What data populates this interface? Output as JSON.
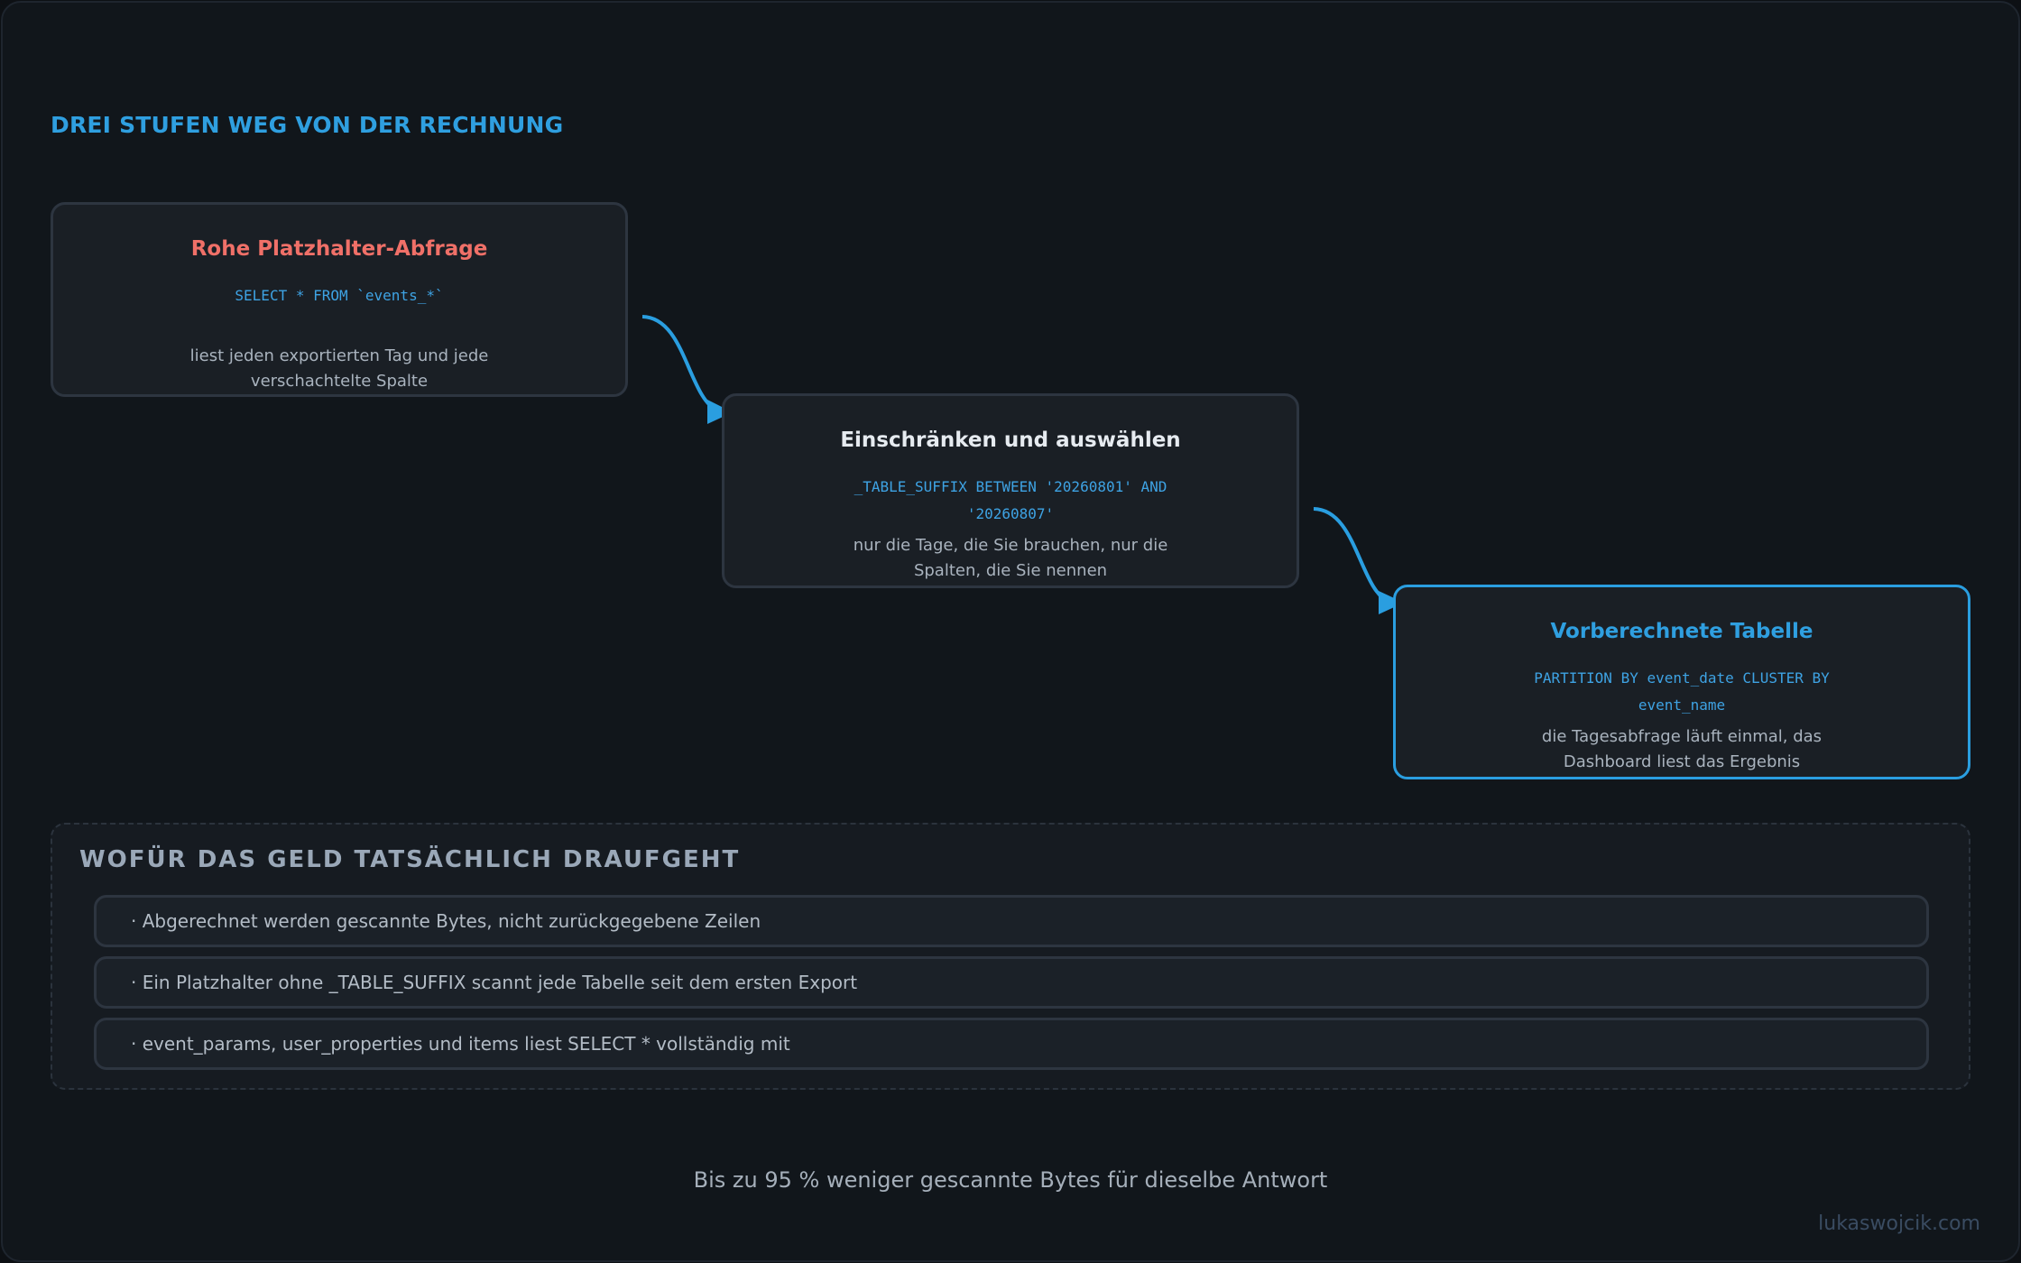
{
  "heading": "DREI STUFEN WEG VON DER RECHNUNG",
  "cards": [
    {
      "title": "Rohe Platzhalter-Abfrage",
      "title_color": "#f07068",
      "code": "SELECT * FROM `events_*`",
      "description": "liest jeden exportierten Tag und jede verschachtelte Spalte"
    },
    {
      "title": "Einschränken und auswählen",
      "title_color": "#e6ebf0",
      "code": "_TABLE_SUFFIX BETWEEN '20260801' AND '20260807'",
      "description": "nur die Tage, die Sie brauchen, nur die Spalten, die Sie nennen"
    },
    {
      "title": "Vorberechnete Tabelle",
      "title_color": "#2f9fe0",
      "code": "PARTITION BY event_date CLUSTER BY event_name",
      "description": "die Tagesabfrage läuft einmal, das Dashboard liest das Ergebnis"
    }
  ],
  "summary": {
    "title": "WOFÜR DAS GELD TATSÄCHLICH DRAUFGEHT",
    "items": [
      "· Abgerechnet werden gescannte Bytes, nicht zurückgegebene Zeilen",
      "· Ein Platzhalter ohne _TABLE_SUFFIX scannt jede Tabelle seit dem ersten Export",
      "· event_params, user_properties und items liest SELECT * vollständig mit"
    ]
  },
  "footer": "Bis zu 95 % weniger gescannte Bytes für dieselbe Antwort",
  "credit": "lukaswojcik.com",
  "colors": {
    "accent": "#2f9fe0",
    "warning": "#f07068",
    "background": "#11161b",
    "card": "#1a1f25"
  }
}
